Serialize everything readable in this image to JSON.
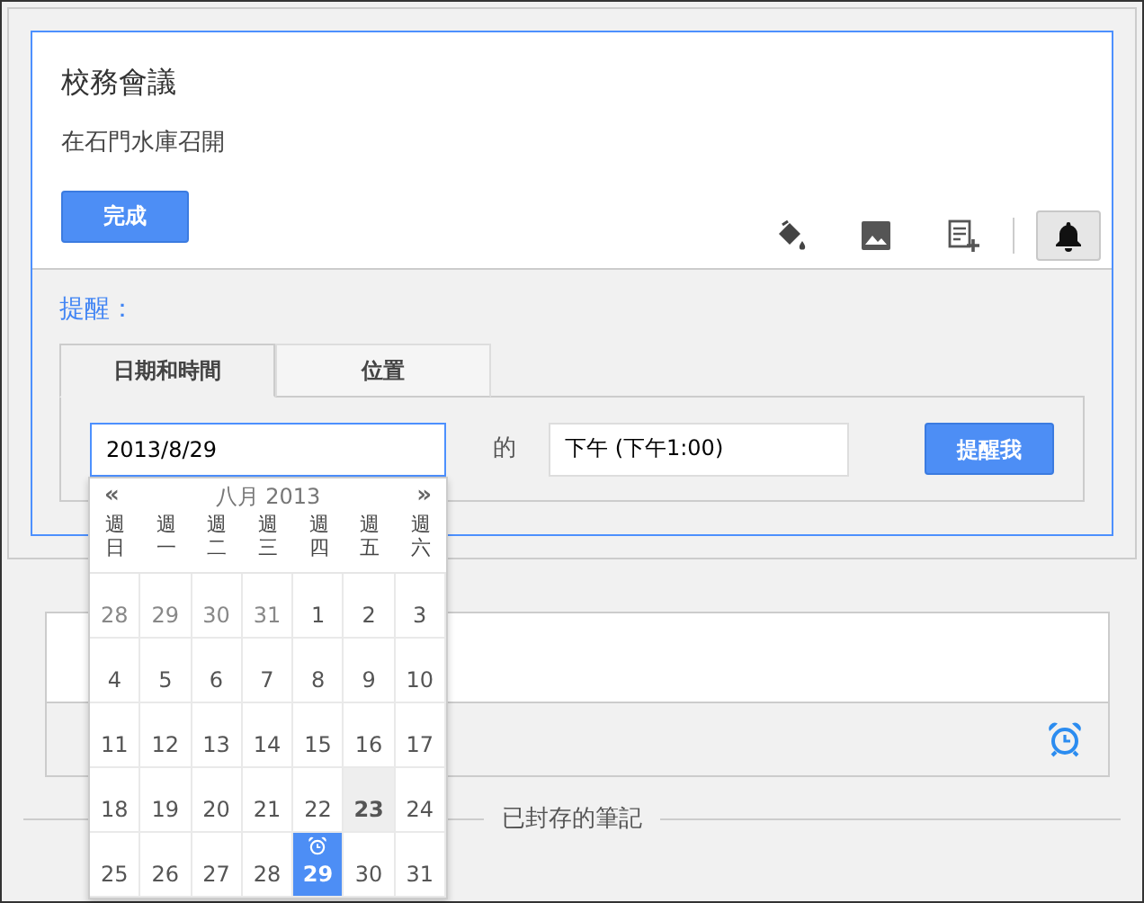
{
  "note": {
    "title": "校務會議",
    "body": "在石門水庫召開",
    "done_button": "完成",
    "toolbar": [
      {
        "kind": "color",
        "selected": false
      },
      {
        "kind": "image",
        "selected": false
      },
      {
        "kind": "list",
        "selected": false
      },
      {
        "kind": "reminder",
        "selected": true
      }
    ]
  },
  "reminder": {
    "label": "提醒：",
    "tabs": [
      {
        "label": "日期和時間",
        "selected": true
      },
      {
        "label": "位置",
        "selected": false
      }
    ],
    "date_value": "2013/8/29",
    "at_label": "的",
    "time_value": "下午 (下午1:00)",
    "submit": "提醒我"
  },
  "calendar": {
    "prev": "«",
    "month": "八月 2013",
    "next": "»",
    "weekdays": [
      "週日",
      "週一",
      "週二",
      "週三",
      "週四",
      "週五",
      "週六"
    ],
    "weeks": [
      [
        {
          "day": "28",
          "other_month": true,
          "today": false,
          "selected": false
        },
        {
          "day": "29",
          "other_month": true,
          "today": false,
          "selected": false
        },
        {
          "day": "30",
          "other_month": true,
          "today": false,
          "selected": false
        },
        {
          "day": "31",
          "other_month": true,
          "today": false,
          "selected": false
        },
        {
          "day": "1",
          "other_month": false,
          "today": false,
          "selected": false
        },
        {
          "day": "2",
          "other_month": false,
          "today": false,
          "selected": false
        },
        {
          "day": "3",
          "other_month": false,
          "today": false,
          "selected": false
        }
      ],
      [
        {
          "day": "4",
          "other_month": false,
          "today": false,
          "selected": false
        },
        {
          "day": "5",
          "other_month": false,
          "today": false,
          "selected": false
        },
        {
          "day": "6",
          "other_month": false,
          "today": false,
          "selected": false
        },
        {
          "day": "7",
          "other_month": false,
          "today": false,
          "selected": false
        },
        {
          "day": "8",
          "other_month": false,
          "today": false,
          "selected": false
        },
        {
          "day": "9",
          "other_month": false,
          "today": false,
          "selected": false
        },
        {
          "day": "10",
          "other_month": false,
          "today": false,
          "selected": false
        }
      ],
      [
        {
          "day": "11",
          "other_month": false,
          "today": false,
          "selected": false
        },
        {
          "day": "12",
          "other_month": false,
          "today": false,
          "selected": false
        },
        {
          "day": "13",
          "other_month": false,
          "today": false,
          "selected": false
        },
        {
          "day": "14",
          "other_month": false,
          "today": false,
          "selected": false
        },
        {
          "day": "15",
          "other_month": false,
          "today": false,
          "selected": false
        },
        {
          "day": "16",
          "other_month": false,
          "today": false,
          "selected": false
        },
        {
          "day": "17",
          "other_month": false,
          "today": false,
          "selected": false
        }
      ],
      [
        {
          "day": "18",
          "other_month": false,
          "today": false,
          "selected": false
        },
        {
          "day": "19",
          "other_month": false,
          "today": false,
          "selected": false
        },
        {
          "day": "20",
          "other_month": false,
          "today": false,
          "selected": false
        },
        {
          "day": "21",
          "other_month": false,
          "today": false,
          "selected": false
        },
        {
          "day": "22",
          "other_month": false,
          "today": false,
          "selected": false
        },
        {
          "day": "23",
          "other_month": false,
          "today": true,
          "selected": false
        },
        {
          "day": "24",
          "other_month": false,
          "today": false,
          "selected": false
        }
      ],
      [
        {
          "day": "25",
          "other_month": false,
          "today": false,
          "selected": false
        },
        {
          "day": "26",
          "other_month": false,
          "today": false,
          "selected": false
        },
        {
          "day": "27",
          "other_month": false,
          "today": false,
          "selected": false
        },
        {
          "day": "28",
          "other_month": false,
          "today": false,
          "selected": false
        },
        {
          "day": "29",
          "other_month": false,
          "today": false,
          "selected": true
        },
        {
          "day": "30",
          "other_month": false,
          "today": false,
          "selected": false
        },
        {
          "day": "31",
          "other_month": false,
          "today": false,
          "selected": false
        }
      ]
    ]
  },
  "archived_label": "已封存的筆記"
}
